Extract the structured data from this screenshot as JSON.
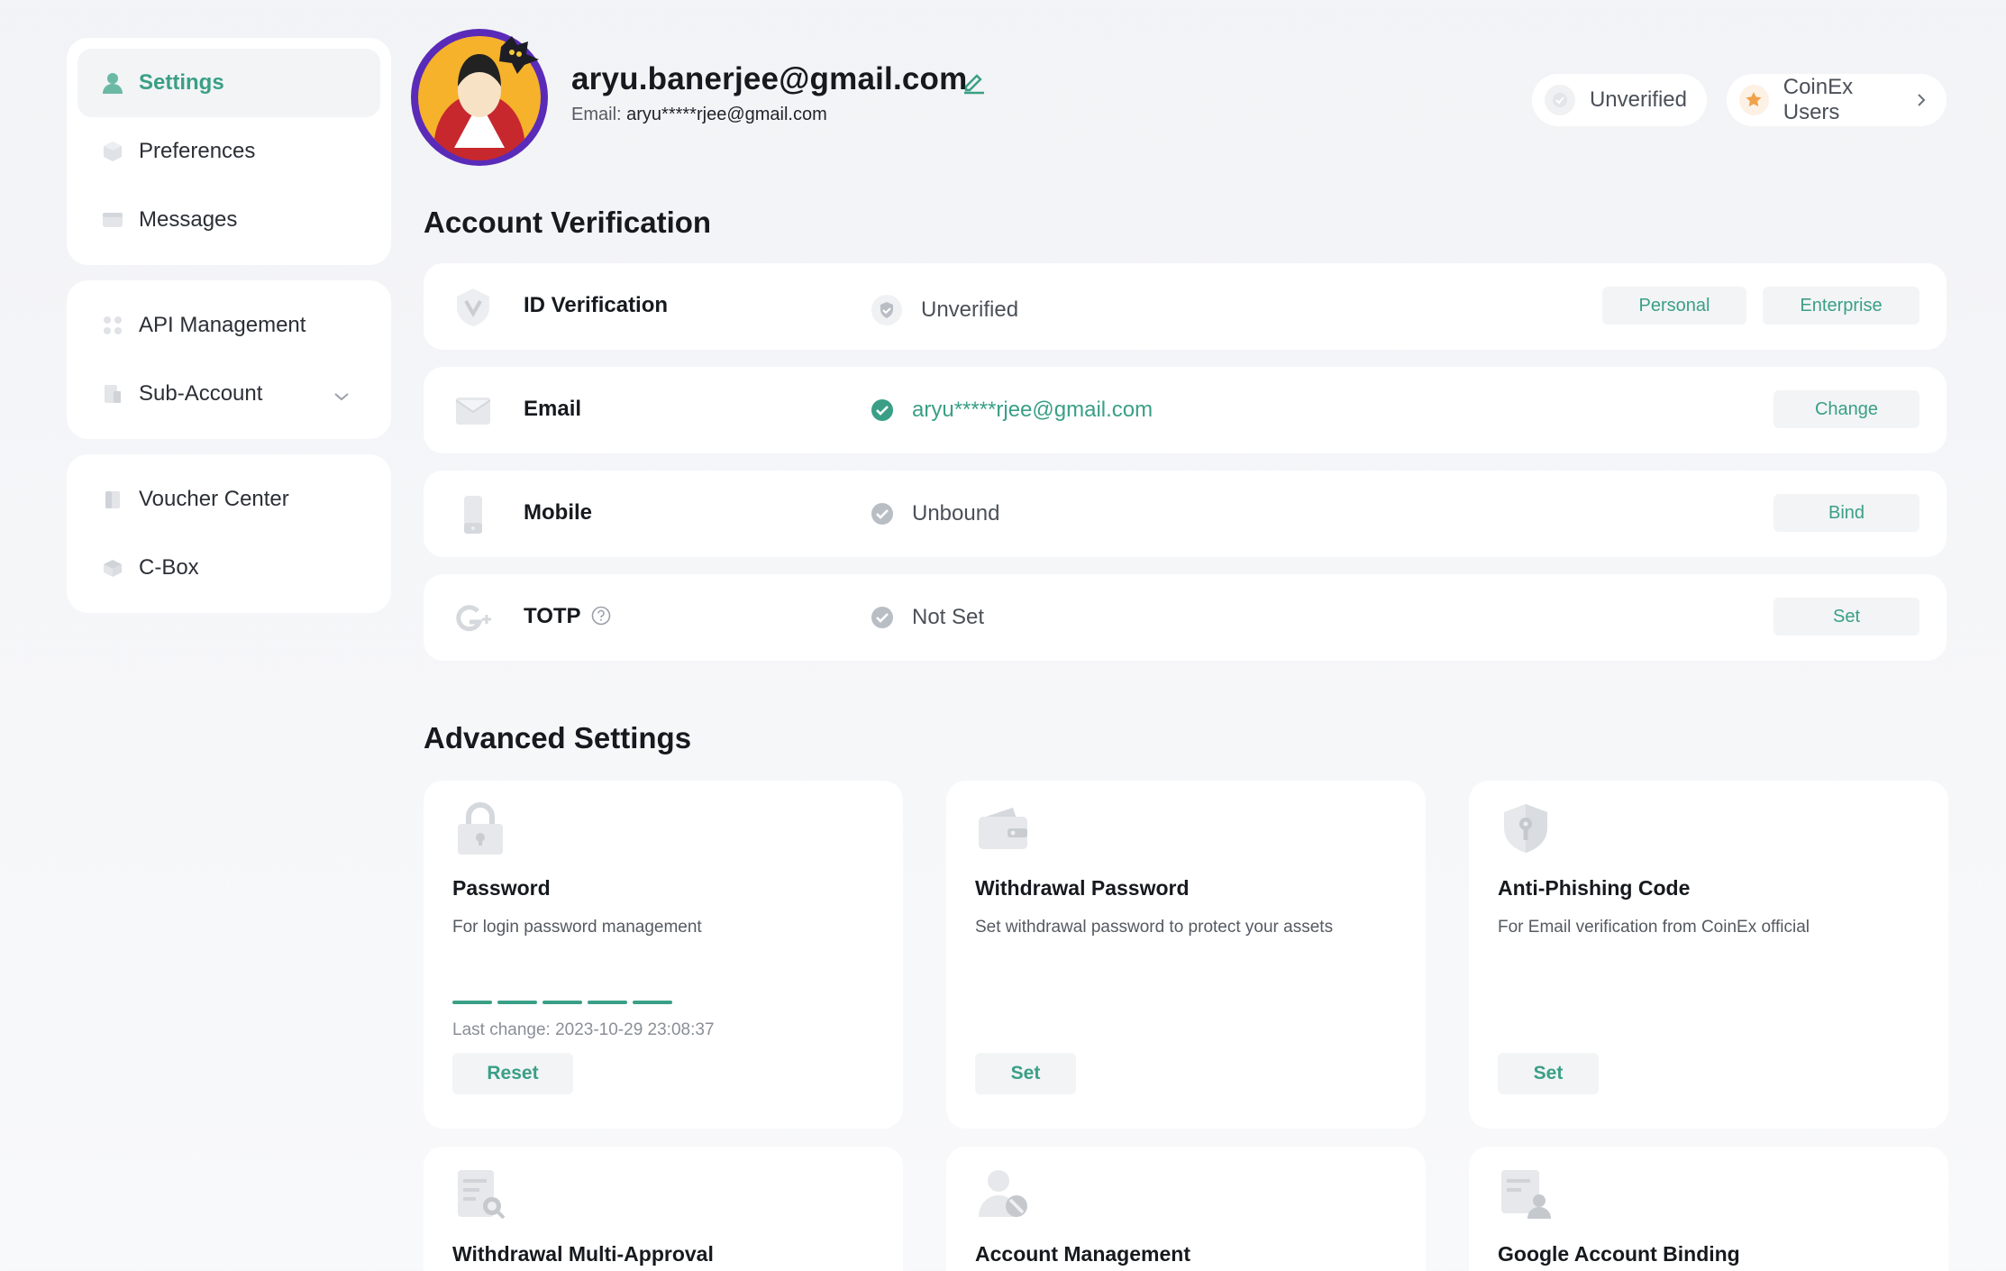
{
  "sidebar": {
    "group1": [
      {
        "label": "Settings",
        "icon": "user-icon",
        "active": true
      },
      {
        "label": "Preferences",
        "icon": "cube-icon"
      },
      {
        "label": "Messages",
        "icon": "message-icon"
      }
    ],
    "group2": [
      {
        "label": "API Management",
        "icon": "api-icon"
      },
      {
        "label": "Sub-Account",
        "icon": "sub-account-icon"
      }
    ],
    "group3": [
      {
        "label": "Voucher Center",
        "icon": "voucher-icon"
      },
      {
        "label": "C-Box",
        "icon": "box-icon"
      }
    ]
  },
  "profile": {
    "username": "aryu.banerjee@gmail.com",
    "email_label": "Email:",
    "email_masked": "aryu*****rjee@gmail.com",
    "status_pill": "Unverified",
    "users_pill": "CoinEx Users"
  },
  "account_verification": {
    "title": "Account Verification",
    "rows": [
      {
        "name": "ID Verification",
        "status": "Unverified",
        "buttons": [
          "Personal",
          "Enterprise"
        ]
      },
      {
        "name": "Email",
        "status": "aryu*****rjee@gmail.com",
        "buttons": [
          "Change"
        ]
      },
      {
        "name": "Mobile",
        "status": "Unbound",
        "buttons": [
          "Bind"
        ]
      },
      {
        "name": "TOTP",
        "status": "Not Set",
        "buttons": [
          "Set"
        ]
      }
    ]
  },
  "advanced_settings": {
    "title": "Advanced Settings",
    "cards": [
      {
        "title": "Password",
        "desc": "For login password management",
        "last_change": "Last change: 2023-10-29 23:08:37",
        "button": "Reset",
        "strength": 5
      },
      {
        "title": "Withdrawal Password",
        "desc": "Set withdrawal password to protect your assets",
        "button": "Set"
      },
      {
        "title": "Anti-Phishing Code",
        "desc": "For Email verification from CoinEx official",
        "button": "Set"
      },
      {
        "title": "Withdrawal Multi-Approval"
      },
      {
        "title": "Account Management"
      },
      {
        "title": "Google Account Binding"
      }
    ]
  },
  "colors": {
    "accent": "#3a9f86",
    "card": "#ffffff",
    "button_bg": "#f2f4f6"
  }
}
